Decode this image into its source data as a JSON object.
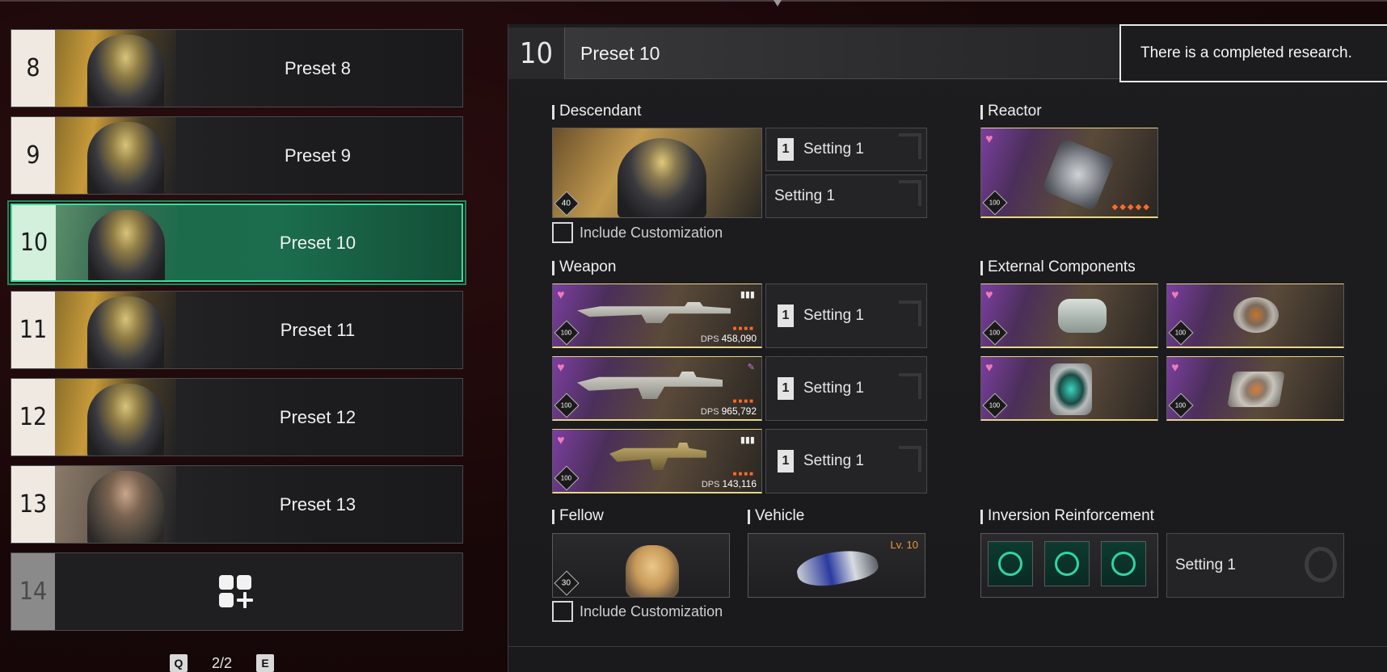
{
  "presets": [
    {
      "number": "8",
      "name": "Preset 8"
    },
    {
      "number": "9",
      "name": "Preset 9"
    },
    {
      "number": "10",
      "name": "Preset 10"
    },
    {
      "number": "11",
      "name": "Preset 11"
    },
    {
      "number": "12",
      "name": "Preset 12"
    },
    {
      "number": "13",
      "name": "Preset 13"
    },
    {
      "number": "14",
      "name": ""
    }
  ],
  "selected_preset": "10",
  "pager": {
    "prev_key": "Q",
    "page": "2/2",
    "next_key": "E"
  },
  "panel": {
    "number": "10",
    "title": "Preset 10"
  },
  "toast": "There is a completed research.",
  "descendant": {
    "label": "Descendant",
    "level": "40",
    "setting_a": "Setting 1",
    "setting_a_slot": "1",
    "setting_b": "Setting 1",
    "include_label": "Include Customization"
  },
  "reactor": {
    "label": "Reactor",
    "level": "100",
    "stars": "◆◆◆◆◆"
  },
  "weapon": {
    "label": "Weapon",
    "items": [
      {
        "level": "100",
        "dps_label": "DPS",
        "dps": "458,090",
        "stars": "■■■■",
        "corner": "▮▮▮",
        "setting": "Setting 1",
        "slot": "1"
      },
      {
        "level": "100",
        "dps_label": "DPS",
        "dps": "965,792",
        "stars": "■■■■",
        "corner": "✎",
        "setting": "Setting 1",
        "slot": "1"
      },
      {
        "level": "100",
        "dps_label": "DPS",
        "dps": "143,116",
        "stars": "■■■■",
        "corner": "▮▮▮",
        "setting": "Setting 1",
        "slot": "1"
      }
    ]
  },
  "external": {
    "label": "External Components",
    "levels": [
      "100",
      "100",
      "100",
      "100"
    ]
  },
  "fellow": {
    "label": "Fellow",
    "level": "30",
    "include_label": "Include Customization"
  },
  "vehicle": {
    "label": "Vehicle",
    "level": "Lv. 10"
  },
  "inversion": {
    "label": "Inversion Reinforcement",
    "setting": "Setting 1"
  },
  "colors": {
    "accent": "#35e0a0",
    "selected_bg": "#1b6d4d",
    "gold_border": "#e6d68a",
    "star": "#ff6a2a"
  }
}
